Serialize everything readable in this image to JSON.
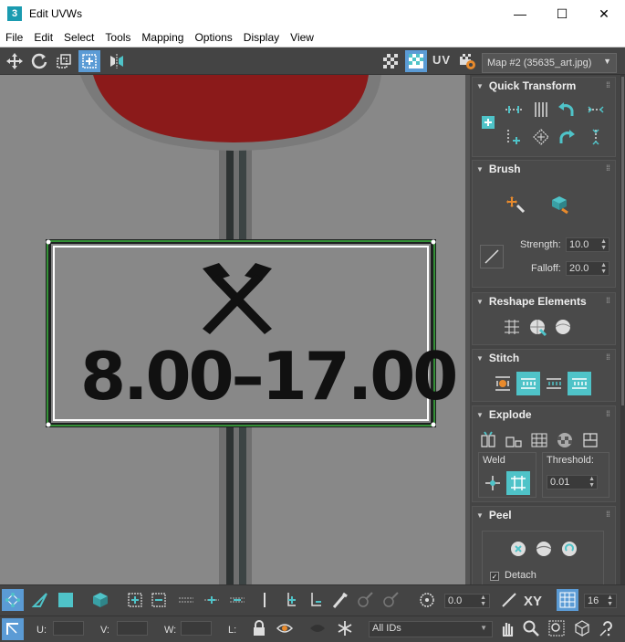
{
  "window": {
    "title": "Edit UVWs",
    "app_icon_text": "3",
    "minimize": "—",
    "maximize": "☐",
    "close": "✕"
  },
  "menu": [
    "File",
    "Edit",
    "Select",
    "Tools",
    "Mapping",
    "Options",
    "Display",
    "View"
  ],
  "toolbar_top": {
    "uv_label": "UV",
    "map_select": "Map #2 (35635_art.jpg)"
  },
  "viewport": {
    "sign_text": "8.00–17.00",
    "colors": {
      "background": "#888888",
      "stop_sign": "#8b1a1a",
      "uv_edge": "#4cff4c"
    }
  },
  "panel": {
    "quick_transform": {
      "title": "Quick Transform"
    },
    "brush": {
      "title": "Brush",
      "strength_label": "Strength:",
      "strength_value": "10.0",
      "falloff_label": "Falloff:",
      "falloff_value": "20.0"
    },
    "reshape": {
      "title": "Reshape Elements"
    },
    "stitch": {
      "title": "Stitch"
    },
    "explode": {
      "title": "Explode",
      "weld_label": "Weld",
      "threshold_label": "Threshold:",
      "threshold_value": "0.01"
    },
    "peel": {
      "title": "Peel",
      "detach_label": "Detach",
      "detach_checked": true
    }
  },
  "bottom": {
    "angle_value": "0.0",
    "xy_label": "XY",
    "grid_value": "16",
    "u_label": "U:",
    "v_label": "V:",
    "w_label": "W:",
    "l_label": "L:",
    "ids_select": "All IDs"
  },
  "accent_color": "#4fc3c8"
}
